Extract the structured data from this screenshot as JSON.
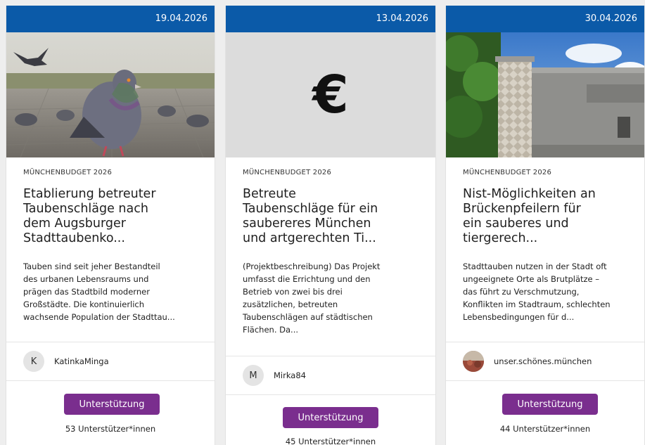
{
  "cards": [
    {
      "date": "19.04.2026",
      "category": "MÜNCHENBUDGET 2026",
      "title": "Etablierung betreuter\nTaubenschläge nach\ndem Augsburger\nStadttaubenko...",
      "description": "Tauben sind seit jeher Bestandteil\ndes urbanen Lebensraums und\nprägen das Stadtbild moderner\nGroßstädte. Die kontinuierlich\nwachsende Population der Stadttau...",
      "author_initial": "K",
      "author": "KatinkaMinga",
      "button": "Unterstützung",
      "supporters": "53 Unterstützer*innen"
    },
    {
      "date": "13.04.2026",
      "category": "MÜNCHENBUDGET 2026",
      "image_glyph": "€",
      "title": "Betreute\nTaubenschläge für ein\nsaubereres München\nund artgerechten Ti...",
      "description": "(Projektbeschreibung) Das Projekt\numfasst die Errichtung und den\nBetrieb von zwei bis drei\nzusätzlichen, betreuten\nTaubenschlägen auf städtischen\nFlächen. Da...",
      "author_initial": "M",
      "author": "Mirka84",
      "button": "Unterstützung",
      "supporters": "45 Unterstützer*innen"
    },
    {
      "date": "30.04.2026",
      "category": "MÜNCHENBUDGET 2026",
      "title": "Nist-Möglichkeiten an\nBrückenpfeilern für\nein sauberes und\ntiergerech...",
      "description": "Stadttauben nutzen in der Stadt oft\nungeeignete Orte als Brutplätze –\ndas führt zu Verschmutzung,\nKonflikten im Stadtraum, schlechten\nLebensbedingungen für d...",
      "author": "unser.schönes.münchen",
      "button": "Unterstützung",
      "supporters": "44 Unterstützer*innen"
    }
  ],
  "colors": {
    "date_bar": "#0b5aa8",
    "button": "#7a2e8e",
    "placeholder": "#dcdcdc"
  }
}
